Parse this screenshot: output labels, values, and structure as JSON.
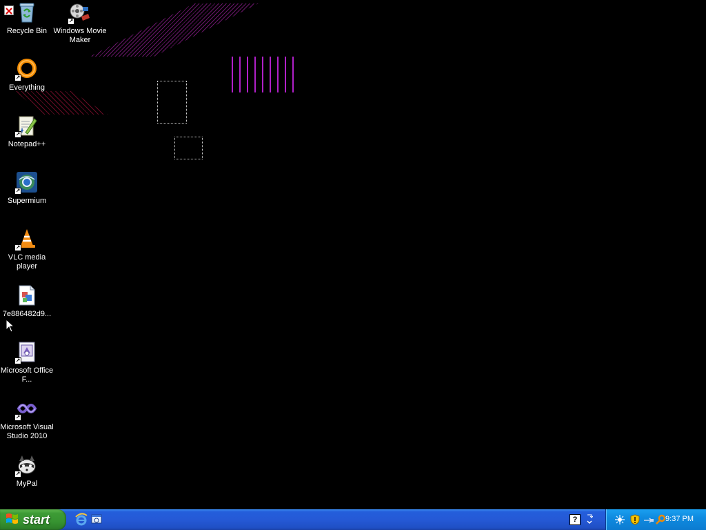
{
  "desktop": {
    "icons": [
      {
        "label": "Recycle Bin",
        "icon": "recycle-bin-icon"
      },
      {
        "label": "Windows Movie Maker",
        "icon": "movie-maker-icon"
      },
      {
        "label": "Everything",
        "icon": "everything-icon"
      },
      {
        "label": "Notepad++",
        "icon": "notepad-plus-plus-icon"
      },
      {
        "label": "Supermium",
        "icon": "supermium-icon"
      },
      {
        "label": "VLC media player",
        "icon": "vlc-icon"
      },
      {
        "label": "7e886482d9...",
        "icon": "image-file-icon"
      },
      {
        "label": "Microsoft Office F...",
        "icon": "office-file-icon"
      },
      {
        "label": "Microsoft Visual Studio 2010",
        "icon": "visual-studio-icon"
      },
      {
        "label": "MyPal",
        "icon": "mypal-icon"
      }
    ]
  },
  "taskbar": {
    "start_label": "start",
    "quick_launch": [
      "internet-explorer-icon",
      "show-desktop-icon"
    ],
    "tray": {
      "help_label": "?",
      "icons": [
        "network-icon",
        "security-shield-icon",
        "usb-icon",
        "search-icon"
      ],
      "clock": "9:37 PM"
    }
  },
  "colors": {
    "desktop_bg": "#000000",
    "taskbar_blue": "#245edb",
    "start_green": "#3d9b35",
    "tray_blue": "#0f8be0"
  }
}
